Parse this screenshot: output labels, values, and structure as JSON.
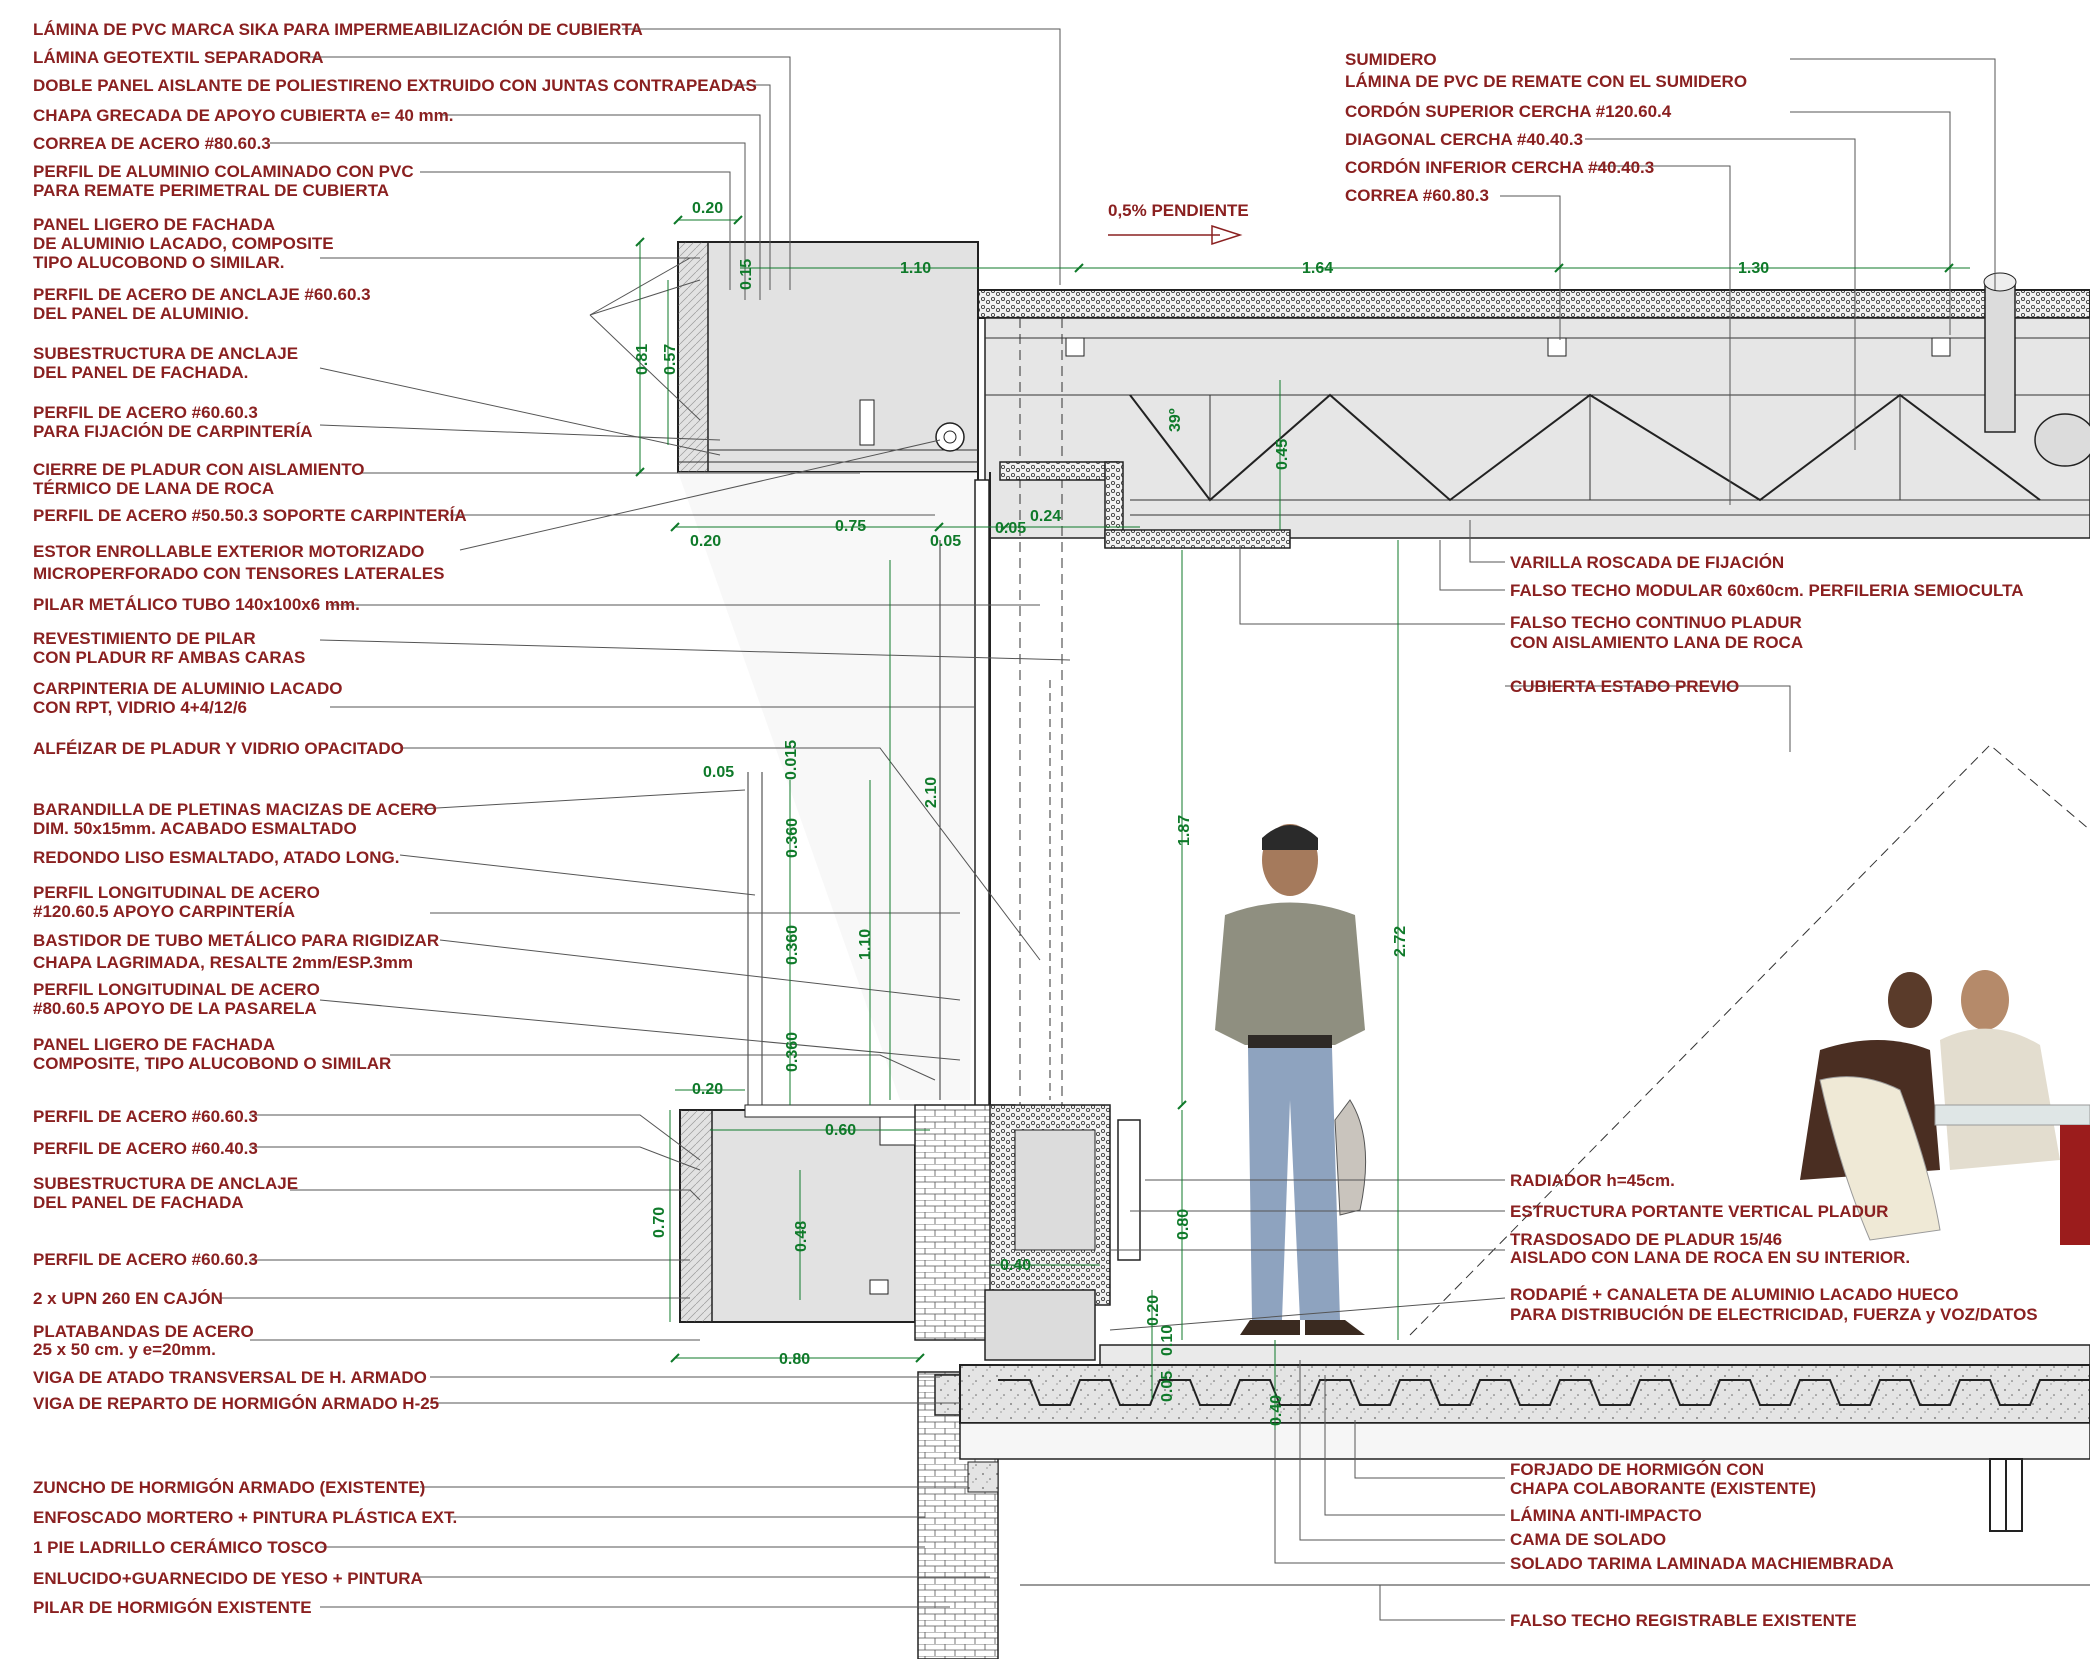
{
  "labels_left": [
    {
      "lines": [
        "LÁMINA DE PVC MARCA SIKA PARA IMPERMEABILIZACIÓN DE CUBIERTA"
      ]
    },
    {
      "lines": [
        "LÁMINA GEOTEXTIL SEPARADORA"
      ]
    },
    {
      "lines": [
        "DOBLE PANEL AISLANTE DE POLIESTIRENO EXTRUIDO CON JUNTAS CONTRAPEADAS"
      ]
    },
    {
      "lines": [
        "CHAPA GRECADA DE APOYO CUBIERTA e= 40 mm."
      ]
    },
    {
      "lines": [
        "CORREA DE ACERO #80.60.3"
      ]
    },
    {
      "lines": [
        "PERFIL DE ALUMINIO COLAMINADO CON PVC",
        "PARA REMATE PERIMETRAL DE CUBIERTA"
      ]
    },
    {
      "lines": [
        "PANEL LIGERO DE FACHADA",
        "DE ALUMINIO LACADO, COMPOSITE",
        "TIPO ALUCOBOND O SIMILAR."
      ]
    },
    {
      "lines": [
        "PERFIL DE ACERO DE ANCLAJE #60.60.3",
        "DEL PANEL DE ALUMINIO."
      ]
    },
    {
      "lines": [
        "SUBESTRUCTURA DE ANCLAJE",
        "DEL PANEL DE FACHADA."
      ]
    },
    {
      "lines": [
        "PERFIL DE ACERO #60.60.3",
        "PARA FIJACIÓN DE CARPINTERÍA"
      ]
    },
    {
      "lines": [
        "CIERRE DE PLADUR CON AISLAMIENTO",
        "TÉRMICO DE LANA DE ROCA"
      ]
    },
    {
      "lines": [
        "PERFIL DE ACERO #50.50.3 SOPORTE CARPINTERÍA"
      ]
    },
    {
      "lines": [
        "ESTOR ENROLLABLE EXTERIOR MOTORIZADO",
        "MICROPERFORADO CON TENSORES LATERALES"
      ]
    },
    {
      "lines": [
        "PILAR METÁLICO TUBO 140x100x6 mm."
      ]
    },
    {
      "lines": [
        "REVESTIMIENTO DE PILAR",
        "CON PLADUR RF AMBAS CARAS"
      ]
    },
    {
      "lines": [
        "CARPINTERIA DE ALUMINIO LACADO",
        "CON RPT, VIDRIO 4+4/12/6"
      ]
    },
    {
      "lines": [
        "ALFÉIZAR DE PLADUR Y VIDRIO OPACITADO"
      ]
    },
    {
      "lines": [
        "BARANDILLA DE PLETINAS MACIZAS DE ACERO",
        "DIM. 50x15mm. ACABADO ESMALTADO"
      ]
    },
    {
      "lines": [
        "REDONDO LISO ESMALTADO, ATADO LONG."
      ]
    },
    {
      "lines": [
        "PERFIL LONGITUDINAL DE ACERO",
        "#120.60.5 APOYO CARPINTERÍA"
      ]
    },
    {
      "lines": [
        "BASTIDOR DE TUBO METÁLICO PARA RIGIDIZAR",
        "CHAPA LAGRIMADA, RESALTE 2mm/ESP.3mm"
      ]
    },
    {
      "lines": [
        "PERFIL LONGITUDINAL DE ACERO",
        "#80.60.5 APOYO DE LA PASARELA"
      ]
    },
    {
      "lines": [
        "PANEL LIGERO DE FACHADA",
        "COMPOSITE, TIPO ALUCOBOND O SIMILAR"
      ]
    },
    {
      "lines": [
        "PERFIL DE ACERO #60.60.3"
      ]
    },
    {
      "lines": [
        "PERFIL DE ACERO #60.40.3"
      ]
    },
    {
      "lines": [
        "SUBESTRUCTURA DE ANCLAJE",
        "DEL PANEL DE FACHADA"
      ]
    },
    {
      "lines": [
        "PERFIL DE ACERO #60.60.3"
      ]
    },
    {
      "lines": [
        "2 x UPN 260 EN CAJÓN"
      ]
    },
    {
      "lines": [
        "PLATABANDAS DE ACERO",
        "25 x 50 cm. y e=20mm."
      ]
    },
    {
      "lines": [
        "VIGA DE ATADO TRANSVERSAL DE H. ARMADO"
      ]
    },
    {
      "lines": [
        "VIGA DE REPARTO DE HORMIGÓN ARMADO H-25"
      ]
    },
    {
      "lines": [
        "ZUNCHO DE HORMIGÓN ARMADO (EXISTENTE)"
      ]
    },
    {
      "lines": [
        "ENFOSCADO MORTERO + PINTURA PLÁSTICA EXT."
      ]
    },
    {
      "lines": [
        "1 PIE LADRILLO CERÁMICO TOSCO"
      ]
    },
    {
      "lines": [
        "ENLUCIDO+GUARNECIDO DE YESO + PINTURA"
      ]
    },
    {
      "lines": [
        "PILAR DE HORMIGÓN EXISTENTE"
      ]
    }
  ],
  "labels_top_right": [
    {
      "lines": [
        "SUMIDERO",
        "LÁMINA DE PVC DE REMATE CON EL SUMIDERO"
      ]
    },
    {
      "lines": [
        "CORDÓN SUPERIOR CERCHA #120.60.4"
      ]
    },
    {
      "lines": [
        "DIAGONAL CERCHA #40.40.3"
      ]
    },
    {
      "lines": [
        "CORDÓN INFERIOR CERCHA #40.40.3"
      ]
    },
    {
      "lines": [
        "CORREA #60.80.3"
      ]
    }
  ],
  "labels_right": [
    {
      "lines": [
        "VARILLA ROSCADA DE FIJACIÓN"
      ]
    },
    {
      "lines": [
        "FALSO TECHO MODULAR 60x60cm. PERFILERIA SEMIOCULTA"
      ]
    },
    {
      "lines": [
        "FALSO TECHO CONTINUO PLADUR",
        "CON AISLAMIENTO LANA DE ROCA"
      ]
    },
    {
      "lines": [
        "CUBIERTA ESTADO PREVIO"
      ]
    },
    {
      "lines": [
        "RADIADOR h=45cm."
      ]
    },
    {
      "lines": [
        "ESTRUCTURA PORTANTE VERTICAL PLADUR"
      ]
    },
    {
      "lines": [
        "TRASDOSADO DE PLADUR 15/46",
        "AISLADO CON LANA DE ROCA EN SU INTERIOR."
      ]
    },
    {
      "lines": [
        "RODAPIÉ + CANALETA DE ALUMINIO LACADO HUECO",
        "PARA DISTRIBUCIÓN DE ELECTRICIDAD, FUERZA y VOZ/DATOS"
      ]
    },
    {
      "lines": [
        "FORJADO DE HORMIGÓN CON",
        "CHAPA COLABORANTE (EXISTENTE)"
      ]
    },
    {
      "lines": [
        "LÁMINA ANTI-IMPACTO"
      ]
    },
    {
      "lines": [
        "CAMA DE SOLADO"
      ]
    },
    {
      "lines": [
        "SOLADO TARIMA LAMINADA MACHIEMBRADA"
      ]
    },
    {
      "lines": [
        "FALSO TECHO REGISTRABLE EXISTENTE"
      ]
    }
  ],
  "annotations": {
    "slope": "0,5% PENDIENTE",
    "angle": "39º"
  },
  "dimensions": [
    {
      "id": "dim-0-20-top",
      "text": "0.20"
    },
    {
      "id": "dim-0-15",
      "text": "0.15"
    },
    {
      "id": "dim-1-10-roof",
      "text": "1.10"
    },
    {
      "id": "dim-1-64",
      "text": "1.64"
    },
    {
      "id": "dim-1-30",
      "text": "1.30"
    },
    {
      "id": "dim-0-81",
      "text": "0.81"
    },
    {
      "id": "dim-0-57",
      "text": "0.57"
    },
    {
      "id": "dim-0-45",
      "text": "0.45"
    },
    {
      "id": "dim-0-20-mid",
      "text": "0.20"
    },
    {
      "id": "dim-0-75",
      "text": "0.75"
    },
    {
      "id": "dim-0-05-a",
      "text": "0.05"
    },
    {
      "id": "dim-0-05-b",
      "text": "0.05"
    },
    {
      "id": "dim-0-24",
      "text": "0.24"
    },
    {
      "id": "dim-0-05-c",
      "text": "0.05"
    },
    {
      "id": "dim-0-015",
      "text": "0.015"
    },
    {
      "id": "dim-2-10",
      "text": "2.10"
    },
    {
      "id": "dim-1-87",
      "text": "1.87"
    },
    {
      "id": "dim-2-72",
      "text": "2.72"
    },
    {
      "id": "dim-0-360-a",
      "text": "0.360"
    },
    {
      "id": "dim-0-360-b",
      "text": "0.360"
    },
    {
      "id": "dim-0-360-c",
      "text": "0.360"
    },
    {
      "id": "dim-1-10-rail",
      "text": "1.10"
    },
    {
      "id": "dim-0-20-low",
      "text": "0.20"
    },
    {
      "id": "dim-0-60",
      "text": "0.60"
    },
    {
      "id": "dim-0-70",
      "text": "0.70"
    },
    {
      "id": "dim-0-48",
      "text": "0.48"
    },
    {
      "id": "dim-0-40-a",
      "text": "0.40"
    },
    {
      "id": "dim-0-80-v",
      "text": "0.80"
    },
    {
      "id": "dim-0-20-v",
      "text": "0.20"
    },
    {
      "id": "dim-0-10",
      "text": "0.10"
    },
    {
      "id": "dim-0-05-d",
      "text": "0.05"
    },
    {
      "id": "dim-0-40-b",
      "text": "0.40"
    },
    {
      "id": "dim-0-80-h",
      "text": "0.80"
    }
  ],
  "colors": {
    "label": "#8a2020",
    "dimension": "#0f7a2a",
    "section_fill": "#d9d9d9",
    "line": "#222222"
  }
}
